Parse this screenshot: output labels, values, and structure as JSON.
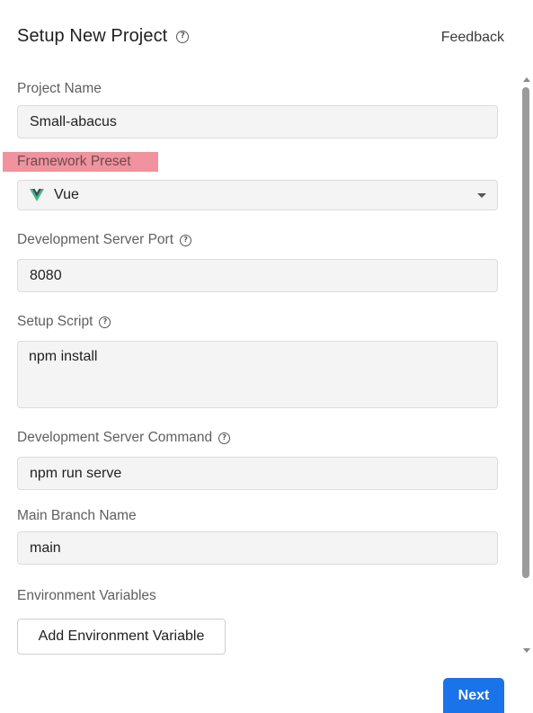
{
  "header": {
    "title": "Setup New Project",
    "feedback_label": "Feedback"
  },
  "form": {
    "project_name": {
      "label": "Project Name",
      "value": "Small-abacus"
    },
    "framework_preset": {
      "label": "Framework Preset",
      "value": "Vue",
      "icon": "vue-logo-icon"
    },
    "dev_server_port": {
      "label": "Development Server Port",
      "value": "8080"
    },
    "setup_script": {
      "label": "Setup Script",
      "value": "npm install"
    },
    "dev_server_command": {
      "label": "Development Server Command",
      "value": "npm run serve"
    },
    "main_branch": {
      "label": "Main Branch Name",
      "value": "main"
    },
    "env_vars": {
      "label": "Environment Variables",
      "add_button_label": "Add Environment Variable"
    }
  },
  "footer": {
    "next_label": "Next"
  },
  "colors": {
    "accent": "#1a73e8",
    "highlight": "#f0939e",
    "vue_green": "#41b883",
    "vue_dark": "#35495e"
  }
}
